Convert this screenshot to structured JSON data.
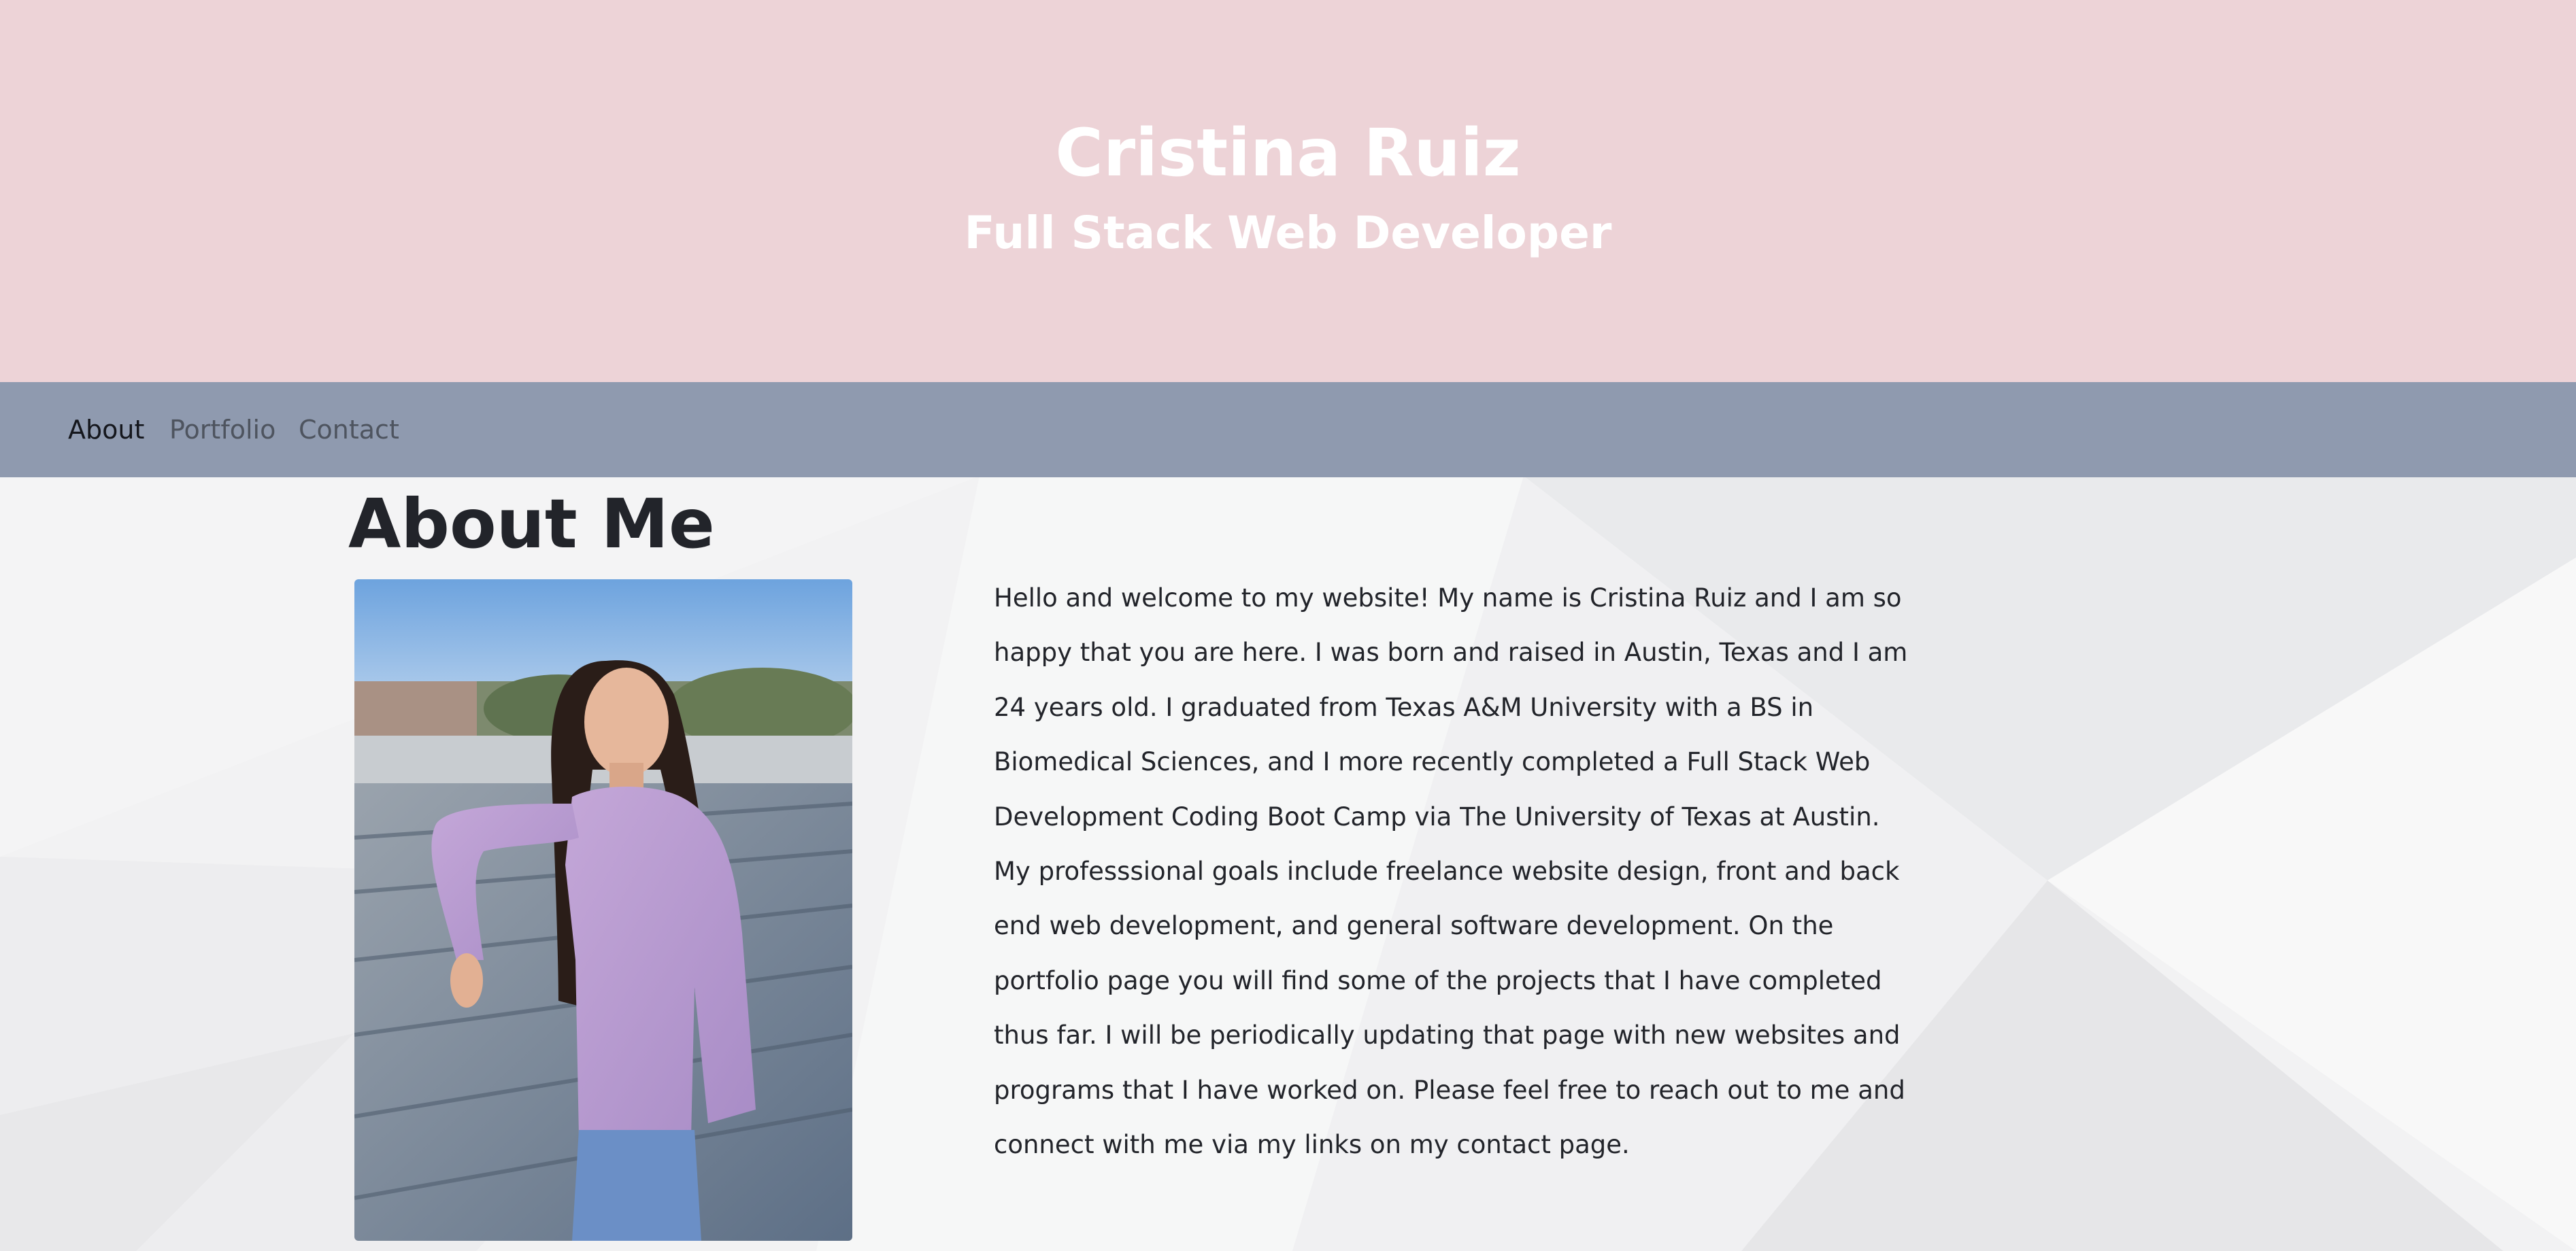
{
  "header": {
    "name": "Cristina Ruiz",
    "role": "Full Stack Web Developer"
  },
  "nav": {
    "items": [
      {
        "label": "About",
        "active": true
      },
      {
        "label": "Portfolio",
        "active": false
      },
      {
        "label": "Contact",
        "active": false
      }
    ]
  },
  "about": {
    "title": "About Me",
    "bio": "Hello and welcome to my website! My name is Cristina Ruiz and I am so happy that you are here. I was born and raised in Austin, Texas and I am 24 years old. I graduated from Texas A&M University with a BS in Biomedical Sciences, and I more recently completed a Full Stack Web Development Coding Boot Camp via The University of Texas at Austin. My professsional goals include freelance website design, front and back end web development, and general software development. On the portfolio page you will find some of the projects that I have completed thus far. I will be periodically updating that page with new websites and programs that I have worked on. Please feel free to reach out to me and connect with me via my links on my contact page."
  },
  "colors": {
    "header_bg": "#edd3d7",
    "nav_bg": "#8f9aaf",
    "page_bg": "#f2f2f3",
    "text": "#22242a"
  }
}
